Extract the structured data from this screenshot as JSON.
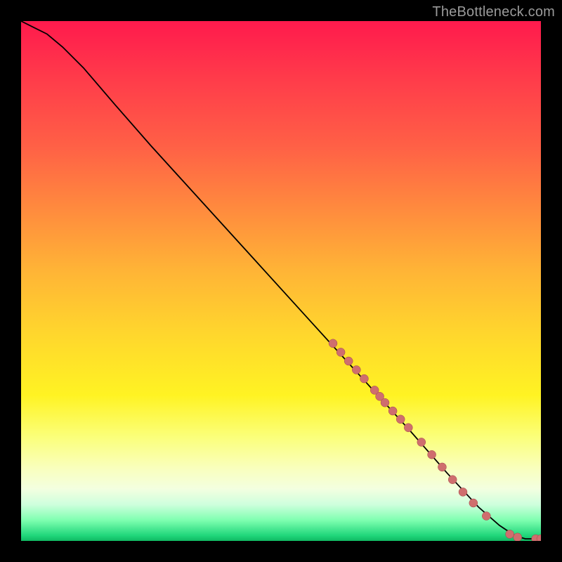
{
  "watermark": "TheBottleneck.com",
  "colors": {
    "frame": "#000000",
    "curve": "#000000",
    "point_fill": "#cf6e6e",
    "point_stroke": "#a04848",
    "gradient_stops": [
      "#ff1a4d",
      "#ff8a3e",
      "#ffd62d",
      "#fff323",
      "#1fd67a"
    ]
  },
  "chart_data": {
    "type": "line",
    "title": "",
    "xlabel": "",
    "ylabel": "",
    "xlim": [
      0,
      100
    ],
    "ylim": [
      0,
      100
    ],
    "grid": false,
    "curve": [
      {
        "x": 0,
        "y": 100
      },
      {
        "x": 2,
        "y": 99
      },
      {
        "x": 5,
        "y": 97.5
      },
      {
        "x": 8,
        "y": 95
      },
      {
        "x": 12,
        "y": 91
      },
      {
        "x": 18,
        "y": 84
      },
      {
        "x": 25,
        "y": 76
      },
      {
        "x": 35,
        "y": 65
      },
      {
        "x": 45,
        "y": 54
      },
      {
        "x": 55,
        "y": 43
      },
      {
        "x": 65,
        "y": 32
      },
      {
        "x": 75,
        "y": 21
      },
      {
        "x": 82,
        "y": 13
      },
      {
        "x": 88,
        "y": 6.5
      },
      {
        "x": 92,
        "y": 3
      },
      {
        "x": 95,
        "y": 1
      },
      {
        "x": 97,
        "y": 0.4
      },
      {
        "x": 100,
        "y": 0.4
      }
    ],
    "points": [
      {
        "x": 60,
        "y": 38
      },
      {
        "x": 61.5,
        "y": 36.3
      },
      {
        "x": 63,
        "y": 34.6
      },
      {
        "x": 64.5,
        "y": 32.9
      },
      {
        "x": 66,
        "y": 31.2
      },
      {
        "x": 68,
        "y": 29
      },
      {
        "x": 69,
        "y": 27.8
      },
      {
        "x": 70,
        "y": 26.6
      },
      {
        "x": 71.5,
        "y": 25
      },
      {
        "x": 73,
        "y": 23.4
      },
      {
        "x": 74.5,
        "y": 21.8
      },
      {
        "x": 77,
        "y": 19
      },
      {
        "x": 79,
        "y": 16.6
      },
      {
        "x": 81,
        "y": 14.2
      },
      {
        "x": 83,
        "y": 11.8
      },
      {
        "x": 85,
        "y": 9.4
      },
      {
        "x": 87,
        "y": 7.3
      },
      {
        "x": 89.5,
        "y": 4.8
      },
      {
        "x": 94,
        "y": 1.3
      },
      {
        "x": 95.5,
        "y": 0.7
      },
      {
        "x": 99,
        "y": 0.4
      },
      {
        "x": 100,
        "y": 0.4
      }
    ]
  }
}
